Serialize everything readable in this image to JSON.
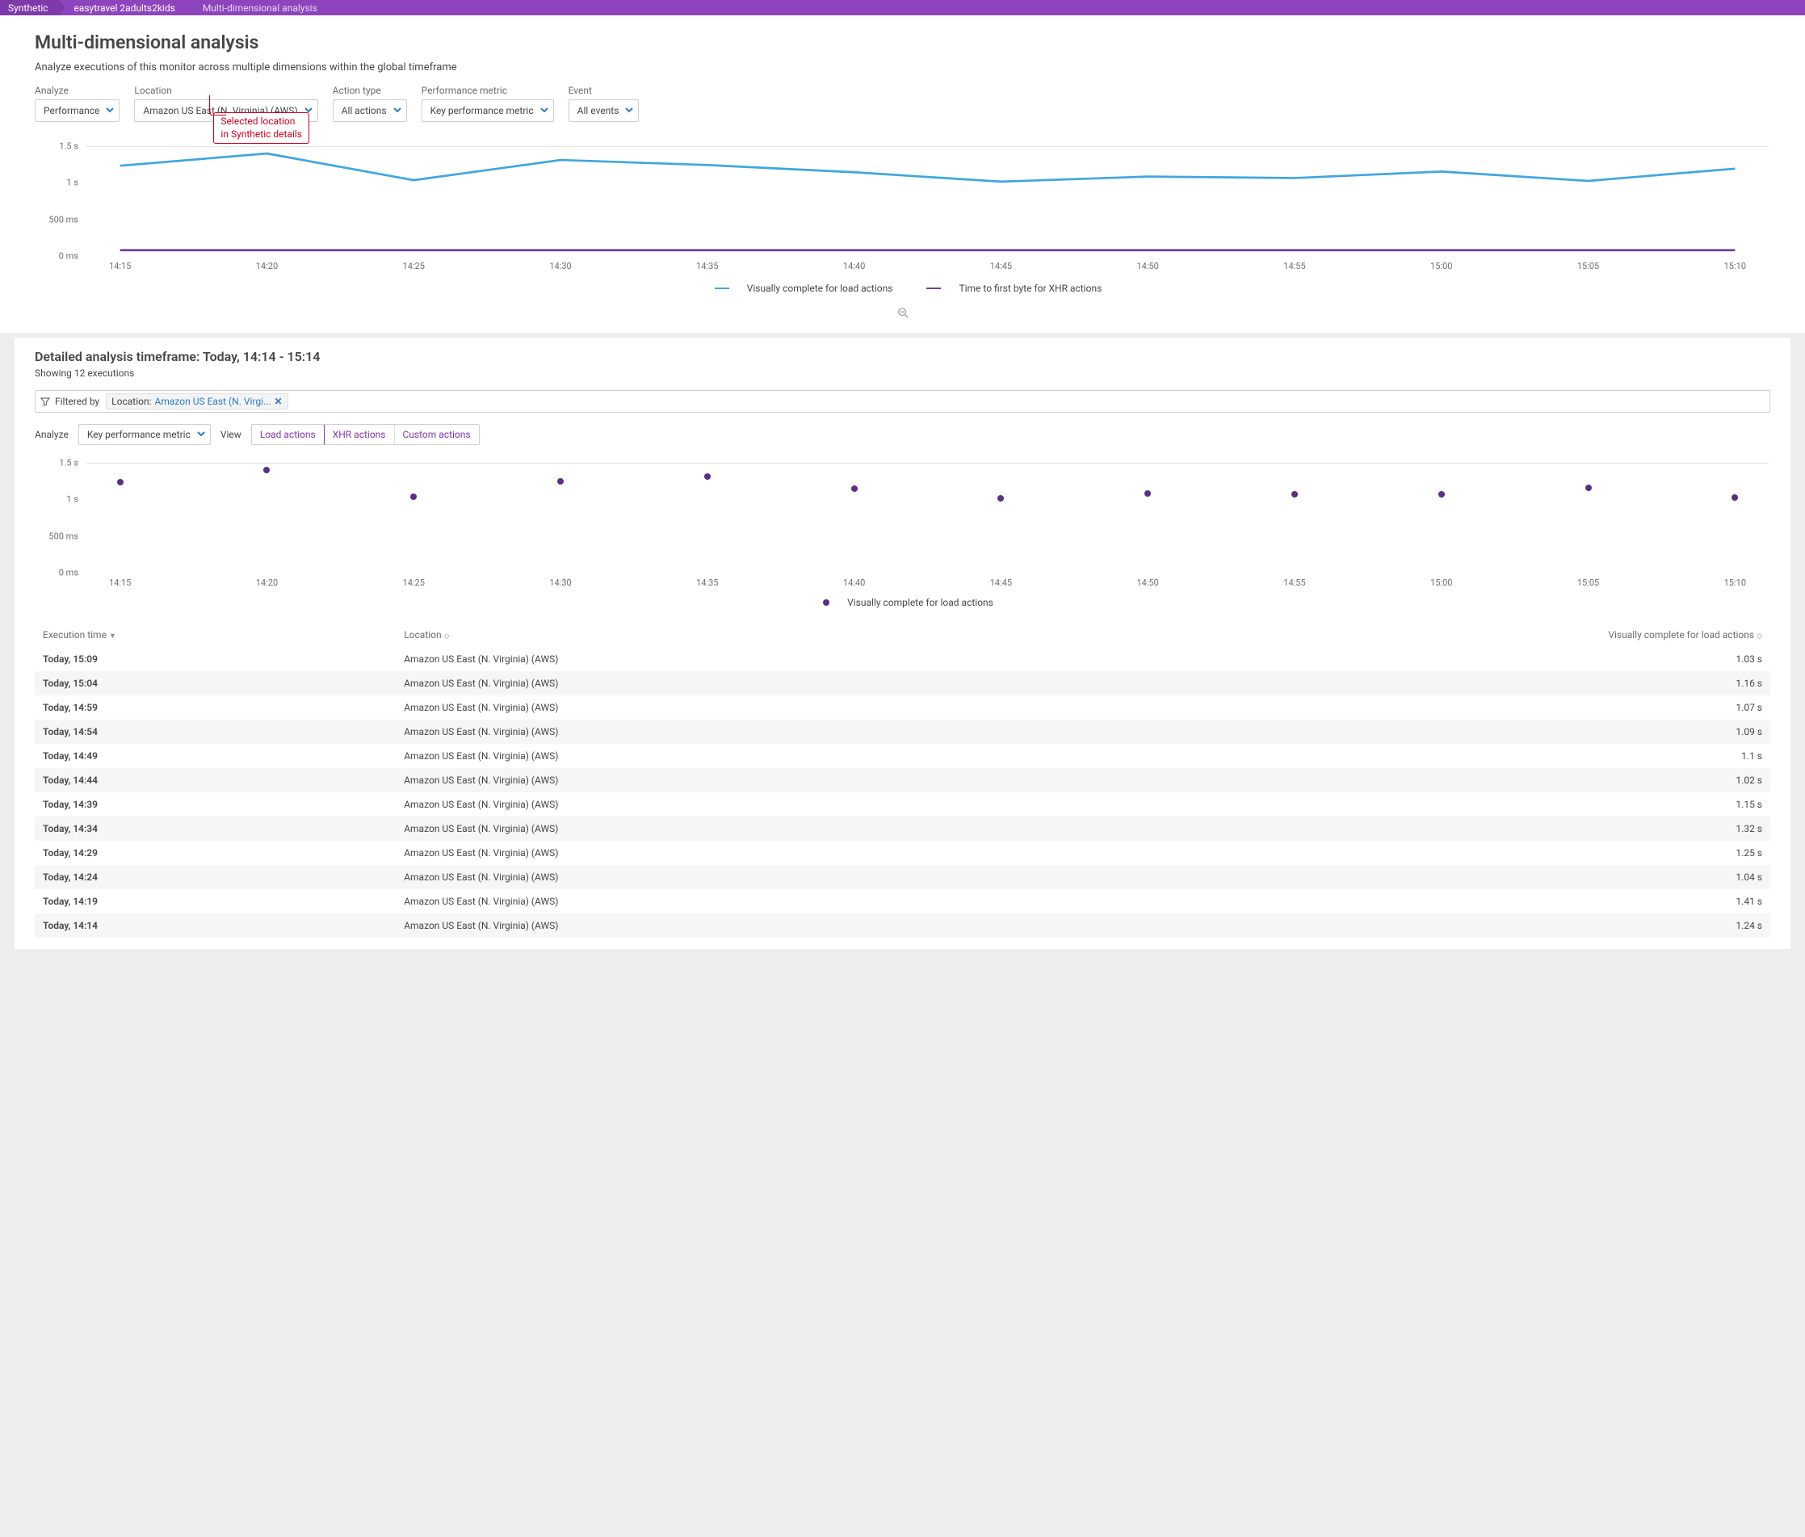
{
  "breadcrumb": {
    "a": "Synthetic",
    "b": "easytravel 2adults2kids",
    "c": "Multi-dimensional analysis"
  },
  "page": {
    "title": "Multi-dimensional analysis",
    "subtitle": "Analyze executions of this monitor across multiple dimensions within the global timeframe"
  },
  "filters": {
    "analyze_label": "Analyze",
    "analyze_value": "Performance",
    "location_label": "Location",
    "location_value": "Amazon US East (N. Virginia) (AWS)",
    "action_label": "Action type",
    "action_value": "All actions",
    "metric_label": "Performance metric",
    "metric_value": "Key performance metric",
    "event_label": "Event",
    "event_value": "All events"
  },
  "callout": {
    "line1": "Selected location",
    "line2": "in Synthetic details"
  },
  "chart_data": {
    "type": "line",
    "xlabel": "",
    "ylabel": "",
    "ylim_ms": [
      0,
      1500
    ],
    "x": [
      "14:15",
      "14:20",
      "14:25",
      "14:30",
      "14:35",
      "14:40",
      "14:45",
      "14:50",
      "14:55",
      "15:00",
      "15:05",
      "15:10"
    ],
    "yticks": [
      {
        "ms": 0,
        "label": "0 ms"
      },
      {
        "ms": 500,
        "label": "500 ms"
      },
      {
        "ms": 1000,
        "label": "1 s"
      },
      {
        "ms": 1500,
        "label": "1.5 s"
      }
    ],
    "series": [
      {
        "name": "Visually complete for load actions",
        "color": "#3fa6e0",
        "values_ms": [
          1240,
          1410,
          1040,
          1320,
          1250,
          1150,
          1020,
          1090,
          1070,
          1160,
          1030,
          1200
        ]
      },
      {
        "name": "Time to first byte for XHR actions",
        "color": "#6f3fa0",
        "values_ms": [
          70,
          70,
          70,
          70,
          70,
          70,
          70,
          70,
          70,
          70,
          70,
          70
        ]
      }
    ]
  },
  "detailed": {
    "heading": "Detailed analysis timeframe: Today, 14:14 - 15:14",
    "showing": "Showing 12 executions",
    "filtered_label": "Filtered by",
    "chip_key": "Location:",
    "chip_value": "Amazon US East (N. Virgi...",
    "analyze_label": "Analyze",
    "analyze_value": "Key performance metric",
    "view_label": "View",
    "view_options": [
      "Load actions",
      "XHR actions",
      "Custom actions"
    ]
  },
  "scatter_data": {
    "type": "scatter",
    "ylim_ms": [
      0,
      1500
    ],
    "x": [
      "14:15",
      "14:20",
      "14:25",
      "14:30",
      "14:35",
      "14:40",
      "14:45",
      "14:50",
      "14:55",
      "15:00",
      "15:05",
      "15:10"
    ],
    "yticks": [
      {
        "ms": 0,
        "label": "0 ms"
      },
      {
        "ms": 500,
        "label": "500 ms"
      },
      {
        "ms": 1000,
        "label": "1 s"
      },
      {
        "ms": 1500,
        "label": "1.5 s"
      }
    ],
    "series": [
      {
        "name": "Visually complete for load actions",
        "color": "#5b2e87",
        "points": [
          {
            "x_index": 0,
            "ms": 1240
          },
          {
            "x_index": 1,
            "ms": 1410
          },
          {
            "x_index": 2,
            "ms": 1040
          },
          {
            "x_index": 3,
            "ms": 1250
          },
          {
            "x_index": 4,
            "ms": 1320
          },
          {
            "x_index": 5,
            "ms": 1150
          },
          {
            "x_index": 6,
            "ms": 1020
          },
          {
            "x_index": 7,
            "ms": 1090
          },
          {
            "x_index": 8,
            "ms": 1070
          },
          {
            "x_index": 9,
            "ms": 1080
          },
          {
            "x_index": 10,
            "ms": 1160
          },
          {
            "x_index": 11,
            "ms": 1030
          }
        ]
      }
    ]
  },
  "table": {
    "columns": {
      "time": "Execution time",
      "location": "Location",
      "metric": "Visually complete for load actions"
    },
    "rows": [
      {
        "time": "Today, 15:09",
        "location": "Amazon US East (N. Virginia) (AWS)",
        "metric": "1.03 s"
      },
      {
        "time": "Today, 15:04",
        "location": "Amazon US East (N. Virginia) (AWS)",
        "metric": "1.16 s"
      },
      {
        "time": "Today, 14:59",
        "location": "Amazon US East (N. Virginia) (AWS)",
        "metric": "1.07 s"
      },
      {
        "time": "Today, 14:54",
        "location": "Amazon US East (N. Virginia) (AWS)",
        "metric": "1.09 s"
      },
      {
        "time": "Today, 14:49",
        "location": "Amazon US East (N. Virginia) (AWS)",
        "metric": "1.1 s"
      },
      {
        "time": "Today, 14:44",
        "location": "Amazon US East (N. Virginia) (AWS)",
        "metric": "1.02 s"
      },
      {
        "time": "Today, 14:39",
        "location": "Amazon US East (N. Virginia) (AWS)",
        "metric": "1.15 s"
      },
      {
        "time": "Today, 14:34",
        "location": "Amazon US East (N. Virginia) (AWS)",
        "metric": "1.32 s"
      },
      {
        "time": "Today, 14:29",
        "location": "Amazon US East (N. Virginia) (AWS)",
        "metric": "1.25 s"
      },
      {
        "time": "Today, 14:24",
        "location": "Amazon US East (N. Virginia) (AWS)",
        "metric": "1.04 s"
      },
      {
        "time": "Today, 14:19",
        "location": "Amazon US East (N. Virginia) (AWS)",
        "metric": "1.41 s"
      },
      {
        "time": "Today, 14:14",
        "location": "Amazon US East (N. Virginia) (AWS)",
        "metric": "1.24 s"
      }
    ]
  }
}
